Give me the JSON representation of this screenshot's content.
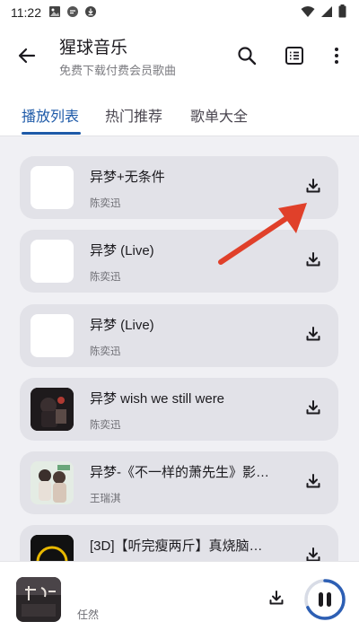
{
  "status_bar": {
    "time": "11:22",
    "left_icons": [
      "gallery-icon",
      "chat-icon",
      "download-status-icon"
    ],
    "right_icons": [
      "wifi-icon",
      "signal-icon",
      "battery-icon"
    ]
  },
  "header": {
    "title": "猩球音乐",
    "subtitle": "免费下载付费会员歌曲",
    "icons": [
      "back-arrow-icon",
      "search-icon",
      "list-icon",
      "more-vert-icon"
    ]
  },
  "tabs": [
    {
      "label": "播放列表",
      "active": true
    },
    {
      "label": "热门推荐",
      "active": false
    },
    {
      "label": "歌单大全",
      "active": false
    }
  ],
  "songs": [
    {
      "title": "异梦+无条件",
      "artist": "陈奕迅",
      "cover": "blank"
    },
    {
      "title": "异梦 (Live)",
      "artist": "陈奕迅",
      "cover": "blank"
    },
    {
      "title": "异梦 (Live)",
      "artist": "陈奕迅",
      "cover": "blank"
    },
    {
      "title": "异梦 wish we still were",
      "artist": "陈奕迅",
      "cover": "dark-art"
    },
    {
      "title": "异梦-《不一样的萧先生》影…",
      "artist": "王瑞淇",
      "cover": "drama-art"
    },
    {
      "title": "[3D]【听完瘦两斤】真烧脑…",
      "artist": "",
      "cover": "yellow-art"
    }
  ],
  "player": {
    "artist": "任然",
    "cover": "album-art",
    "state": "playing",
    "progress": 0.68
  },
  "colors": {
    "accent": "#1e5aa8",
    "card_bg": "#e2e2e8",
    "annotation_arrow": "#e0402a"
  }
}
